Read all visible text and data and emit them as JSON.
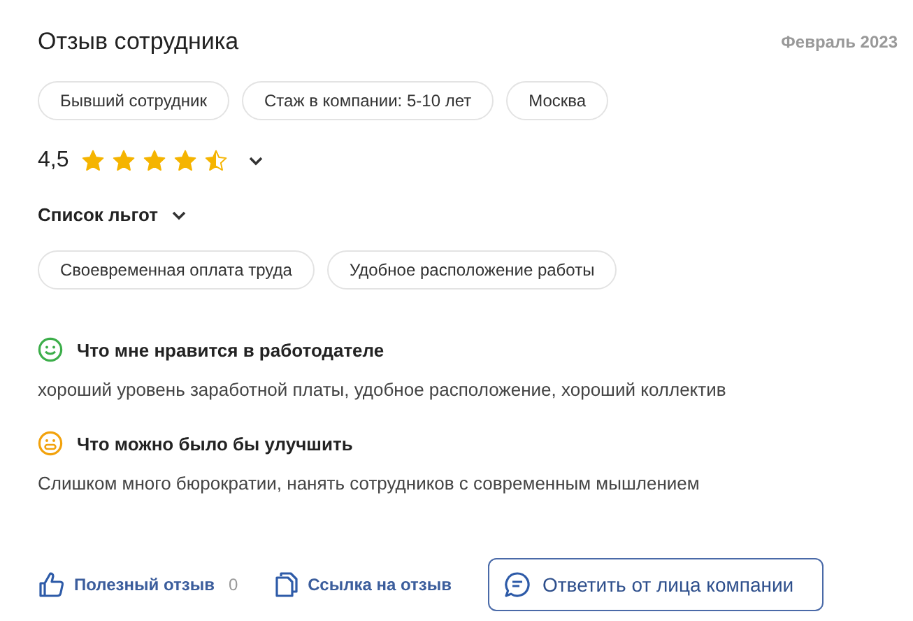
{
  "review": {
    "title": "Отзыв сотрудника",
    "date": "Февраль 2023"
  },
  "tags": [
    "Бывший сотрудник",
    "Стаж в компании: 5-10 лет",
    "Москва"
  ],
  "rating": {
    "value": "4,5",
    "stars": 4.5,
    "expanded": false
  },
  "benefits": {
    "title": "Список льгот",
    "expanded": false,
    "items": [
      "Своевременная оплата труда",
      "Удобное расположение работы"
    ]
  },
  "sections": [
    {
      "kind": "positive",
      "title": "Что мне нравится в работодателе",
      "text": "хороший уровень заработной платы, удобное расположение, хороший коллектив"
    },
    {
      "kind": "negative",
      "title": "Что можно было бы улучшить",
      "text": "Слишком много бюрократии, нанять сотрудников с современным мышлением"
    }
  ],
  "footer": {
    "helpful": "Полезный отзыв",
    "helpful_count": "0",
    "link": "Ссылка на отзыв",
    "reply": "Ответить от лица компании"
  }
}
